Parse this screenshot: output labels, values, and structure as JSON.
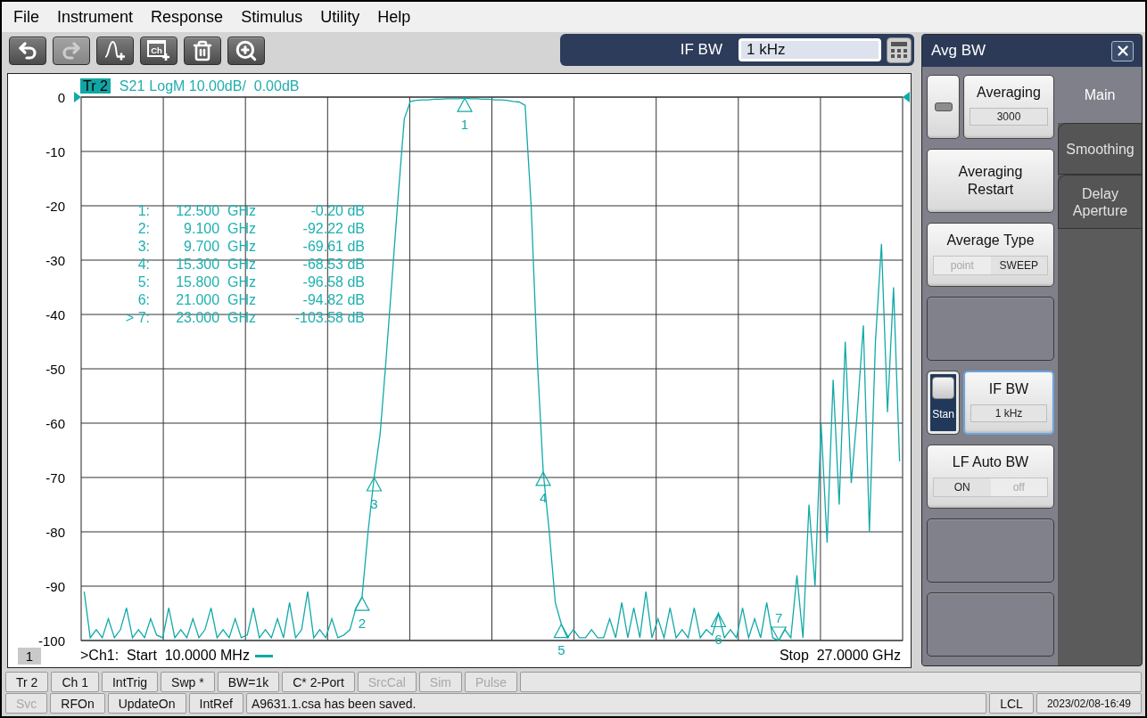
{
  "menu": [
    "File",
    "Instrument",
    "Response",
    "Stimulus",
    "Utility",
    "Help"
  ],
  "toolbar": {
    "buttons": [
      {
        "kind": "undo",
        "disabled": false
      },
      {
        "kind": "redo",
        "disabled": true
      },
      {
        "kind": "trace-add",
        "disabled": false
      },
      {
        "kind": "channel-add",
        "icon_text": "Ch",
        "disabled": false
      },
      {
        "kind": "delete",
        "disabled": false
      },
      {
        "kind": "zoom",
        "disabled": false
      }
    ]
  },
  "entry_bar": {
    "label": "IF BW",
    "value": "1 kHz"
  },
  "chart": {
    "trace_badge": "Tr 2",
    "trace_format": "LogM 10.00dB/  0.00dB",
    "marker_table": [
      {
        "label": "1:",
        "frequency": "12.500  GHz",
        "value": "-0.20 dB"
      },
      {
        "label": "2:",
        "frequency": "9.100  GHz",
        "value": "-92.22 dB"
      },
      {
        "label": "3:",
        "frequency": "9.700  GHz",
        "value": "-69.61 dB"
      },
      {
        "label": "4:",
        "frequency": "15.300  GHz",
        "value": "-68.53 dB"
      },
      {
        "label": "5:",
        "frequency": "15.800  GHz",
        "value": "-96.58 dB"
      },
      {
        "label": "6:",
        "frequency": "21.000  GHz",
        "value": "-94.82 dB"
      },
      {
        "label": "> 7:",
        "frequency": "23.000  GHz",
        "value": "-103.58 dB"
      }
    ],
    "chart_data": {
      "type": "line",
      "grid": true,
      "ylim": [
        -100,
        0
      ],
      "yticks": [
        0,
        -10,
        -20,
        -30,
        -40,
        -50,
        -60,
        -70,
        -80,
        -90,
        -100
      ],
      "categories": [
        null,
        null,
        null,
        null,
        null,
        null,
        null,
        null,
        null,
        null,
        null,
        null,
        null,
        null,
        null,
        null,
        null,
        null,
        null,
        null,
        null,
        null,
        null,
        null,
        null,
        null,
        null,
        null,
        null,
        null,
        null,
        null,
        null,
        null,
        null,
        null,
        null,
        null,
        null,
        null,
        null,
        null,
        null,
        null,
        null,
        null,
        null,
        null,
        null,
        null,
        null,
        null,
        null,
        null,
        null,
        null,
        null,
        null,
        null,
        null,
        null,
        null,
        null,
        null,
        null,
        null,
        null,
        null,
        null,
        null,
        null,
        null,
        null,
        null,
        null,
        null,
        null,
        null,
        null,
        null,
        null,
        null,
        null,
        null,
        null,
        null,
        null,
        null,
        null,
        null,
        null,
        null,
        null,
        null,
        null,
        null,
        null,
        null,
        null,
        null,
        null,
        null,
        null,
        null,
        null,
        null,
        null,
        null,
        null,
        null,
        null,
        null,
        null,
        null,
        null,
        null,
        null,
        null,
        null,
        null,
        null,
        null,
        null,
        null,
        null,
        null,
        null,
        null,
        null,
        null,
        null,
        null,
        null,
        null,
        null,
        null
      ],
      "series": [
        {
          "name": "S21",
          "color": "#12a9a9",
          "values": [
            -91,
            -99.5,
            -98,
            -99.5,
            -96,
            -99.5,
            -98,
            -94,
            -99.5,
            -98,
            -99.5,
            -96,
            -99,
            -99.5,
            -94,
            -99.5,
            -98,
            -99.5,
            -96,
            -99.5,
            -98,
            -94,
            -99.5,
            -98,
            -99.5,
            -96,
            -99.5,
            -99,
            -94,
            -99.5,
            -98,
            -99.5,
            -96,
            -99.5,
            -93,
            -99.5,
            -98,
            -91,
            -99.5,
            -98,
            -99.5,
            -96,
            -99.5,
            -99,
            -98,
            -94,
            -92,
            -80,
            -70,
            -62,
            -48,
            -33,
            -18,
            -4,
            -0.8,
            -0.6,
            -0.5,
            -0.5,
            -0.4,
            -0.4,
            -0.3,
            -0.3,
            -0.3,
            -0.2,
            -0.3,
            -0.3,
            -0.4,
            -0.4,
            -0.5,
            -0.5,
            -0.6,
            -0.8,
            -0.9,
            -1.5,
            -20,
            -48,
            -69,
            -80,
            -93,
            -97,
            -99.5,
            -98,
            -99.5,
            -99.5,
            -98,
            -99.5,
            -99.5,
            -96,
            -99.5,
            -93,
            -99.5,
            -94,
            -99.5,
            -91,
            -99.5,
            -96,
            -99.5,
            -94,
            -99.5,
            -98,
            -99.5,
            -94,
            -99.5,
            -98,
            -99,
            -95,
            -99.5,
            -98,
            -99.5,
            -94,
            -99.5,
            -96,
            -99.5,
            -93,
            -99.5,
            -100,
            -98,
            -99.5,
            -88,
            -99.5,
            -75,
            -90,
            -60,
            -82,
            -52,
            -75,
            -45,
            -71,
            -58,
            -42,
            -80,
            -45,
            -27,
            -58,
            -35,
            -67
          ]
        }
      ],
      "annotations": [
        {
          "y": -0.2,
          "text": "1"
        },
        {
          "y": -92,
          "text": "2"
        },
        {
          "y": -70,
          "text": "3"
        },
        {
          "y": -69,
          "text": "4"
        },
        {
          "y": -97,
          "text": "5"
        },
        {
          "y": -95,
          "text": "6"
        },
        {
          "y": -100,
          "text": "7"
        }
      ]
    },
    "channel_number": "1",
    "start_label": ">Ch1:  Start  10.0000 MHz",
    "stop_label": "Stop  27.0000 GHz"
  },
  "softkey_panel": {
    "title": "Avg BW",
    "tabs": [
      {
        "label": "Main",
        "selected": true
      },
      {
        "label": "Smoothing",
        "selected": false
      },
      {
        "label": "Delay Aperture",
        "selected": false
      }
    ],
    "rows": [
      {
        "keys": [
          {
            "kind": "toggle",
            "on": false
          },
          {
            "kind": "value",
            "label": "Averaging",
            "value": "3000",
            "focused": false
          }
        ]
      },
      {
        "keys": [
          {
            "kind": "action",
            "label": "Averaging Restart"
          }
        ]
      },
      {
        "keys": [
          {
            "kind": "choice",
            "label": "Average Type",
            "options": [
              {
                "label": "point",
                "selected": false
              },
              {
                "label": "SWEEP",
                "selected": true
              }
            ]
          }
        ]
      },
      {
        "keys": [
          {
            "kind": "blank"
          }
        ]
      },
      {
        "keys": [
          {
            "kind": "toggle",
            "on": true,
            "label": "Stan"
          },
          {
            "kind": "value",
            "label": "IF BW",
            "value": "1 kHz",
            "focused": true
          }
        ]
      },
      {
        "keys": [
          {
            "kind": "choice",
            "label": "LF Auto BW",
            "options": [
              {
                "label": "ON",
                "selected": true
              },
              {
                "label": "off",
                "selected": false
              }
            ]
          }
        ]
      },
      {
        "keys": [
          {
            "kind": "blank"
          }
        ]
      },
      {
        "keys": [
          {
            "kind": "blank"
          }
        ]
      }
    ]
  },
  "status_bar": {
    "upper": [
      {
        "kind": "indicator",
        "label": "Tr 2",
        "disabled": false
      },
      {
        "kind": "indicator",
        "label": "Ch 1",
        "disabled": false
      },
      {
        "kind": "indicator",
        "label": "IntTrig",
        "disabled": false
      },
      {
        "kind": "indicator",
        "label": "Swp *",
        "disabled": false
      },
      {
        "kind": "indicator",
        "label": "BW=1k",
        "disabled": false
      },
      {
        "kind": "indicator",
        "label": "C* 2-Port",
        "disabled": false
      },
      {
        "kind": "indicator",
        "label": "SrcCal",
        "disabled": true
      },
      {
        "kind": "indicator",
        "label": "Sim",
        "disabled": true
      },
      {
        "kind": "indicator",
        "label": "Pulse",
        "disabled": true
      }
    ],
    "lower": [
      {
        "kind": "indicator",
        "label": "Svc",
        "disabled": true
      },
      {
        "kind": "indicator",
        "label": "RFOn",
        "disabled": false
      },
      {
        "kind": "indicator",
        "label": "UpdateOn",
        "disabled": false
      },
      {
        "kind": "indicator",
        "label": "IntRef",
        "disabled": false
      },
      {
        "kind": "message",
        "label": "A9631.1.csa has been saved.",
        "disabled": false
      },
      {
        "kind": "indicator",
        "label": "LCL",
        "disabled": false
      },
      {
        "kind": "timestamp",
        "label": "2023/02/08-16:49",
        "disabled": false
      }
    ]
  }
}
